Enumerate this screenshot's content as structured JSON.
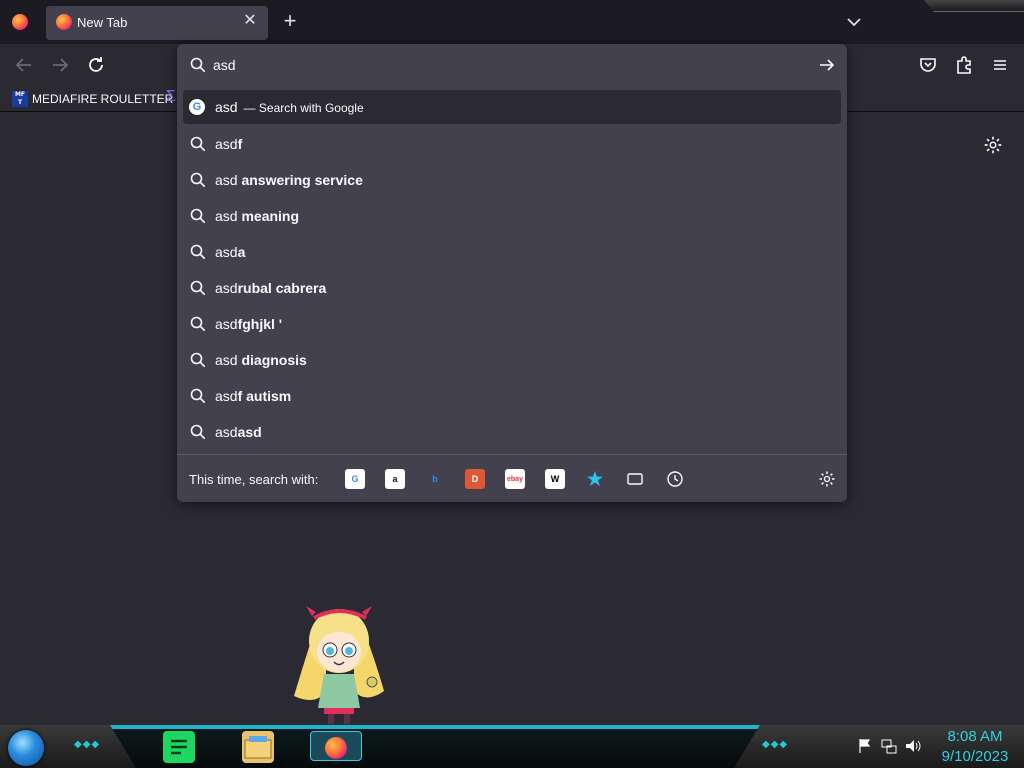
{
  "tab": {
    "title": "New Tab"
  },
  "urlbar": {
    "value": "asd"
  },
  "results": [
    {
      "prefix": "asd",
      "bold": "",
      "action": "— Search with Google",
      "type": "engine",
      "selected": true
    },
    {
      "prefix": "asd",
      "bold": "f",
      "action": "",
      "type": "suggestion"
    },
    {
      "prefix": "asd ",
      "bold": "answering service",
      "action": "",
      "type": "suggestion"
    },
    {
      "prefix": "asd ",
      "bold": "meaning",
      "action": "",
      "type": "suggestion"
    },
    {
      "prefix": "asd",
      "bold": "a",
      "action": "",
      "type": "suggestion"
    },
    {
      "prefix": "asd",
      "bold": "rubal cabrera",
      "action": "",
      "type": "suggestion"
    },
    {
      "prefix": "asd",
      "bold": "fghjkl '",
      "action": "",
      "type": "suggestion"
    },
    {
      "prefix": "asd ",
      "bold": "diagnosis",
      "action": "",
      "type": "suggestion"
    },
    {
      "prefix": "asd",
      "bold": "f autism",
      "action": "",
      "type": "suggestion"
    },
    {
      "prefix": "asd",
      "bold": "asd",
      "action": "",
      "type": "suggestion"
    }
  ],
  "oneoff": {
    "label": "This time, search with:",
    "engines": [
      {
        "name": "google-icon",
        "glyph": "G",
        "bg": "#ffffff",
        "fg": "#4285f4"
      },
      {
        "name": "amazon-icon",
        "glyph": "a",
        "bg": "#ffffff",
        "fg": "#111111"
      },
      {
        "name": "bing-icon",
        "glyph": "b",
        "bg": "transparent",
        "fg": "#2a8cf0"
      },
      {
        "name": "duckduckgo-icon",
        "glyph": "D",
        "bg": "#de5833",
        "fg": "#ffffff"
      },
      {
        "name": "ebay-icon",
        "glyph": "ebay",
        "bg": "#ffffff",
        "fg": "#e53238"
      },
      {
        "name": "wikipedia-icon",
        "glyph": "W",
        "bg": "#ffffff",
        "fg": "#000000"
      },
      {
        "name": "bookmarks-star-icon",
        "glyph": "★",
        "bg": "transparent",
        "fg": "#2ac3f2"
      },
      {
        "name": "tabs-icon",
        "glyph": "",
        "bg": "transparent",
        "fg": "#fbfbfe"
      },
      {
        "name": "history-clock-icon",
        "glyph": "",
        "bg": "transparent",
        "fg": "#fbfbfe"
      }
    ]
  },
  "bookmarks": {
    "item1": "MEDIAFIRE ROULETTER",
    "favicon_text": "MF T"
  },
  "clock": {
    "time": "8:08 AM",
    "date": "9/10/2023"
  },
  "colors": {
    "accent": "#1fb3c9",
    "panel": "#42414d",
    "bg": "#2b2a33"
  }
}
